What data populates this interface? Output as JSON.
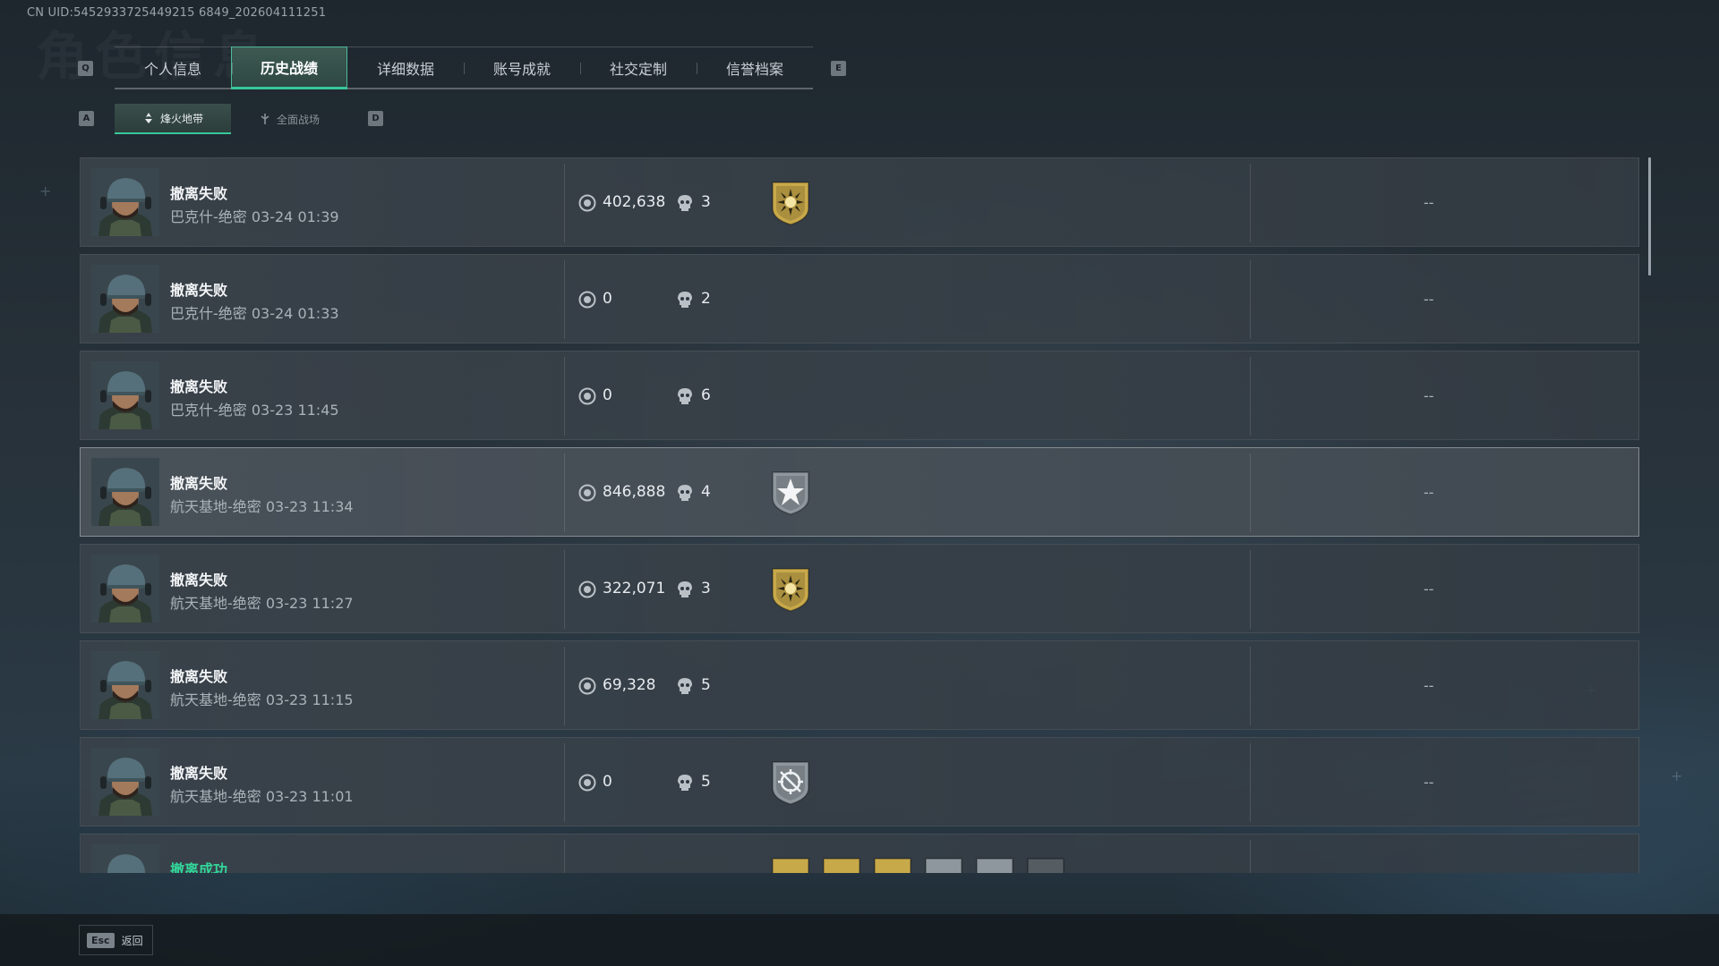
{
  "uid_text": "CN UID:5452933725449215 6849_202604111251",
  "background_title": "角色信息",
  "tabs": {
    "prev_key": "Q",
    "next_key": "E",
    "items": [
      {
        "label": "个人信息"
      },
      {
        "label": "历史战绩",
        "active": true
      },
      {
        "label": "详细数据"
      },
      {
        "label": "账号成就"
      },
      {
        "label": "社交定制"
      },
      {
        "label": "信誉档案"
      }
    ]
  },
  "subtabs": {
    "prev_key": "A",
    "next_key": "D",
    "items": [
      {
        "label": "烽火地带",
        "active": true,
        "icon": "flame-zone-icon"
      },
      {
        "label": "全面战场",
        "icon": "battlefield-icon"
      }
    ]
  },
  "records": [
    {
      "status": "撤离失败",
      "map": "巴克什-绝密 03-24 01:39",
      "value": "402,638",
      "kills": "3",
      "badge": "gold-sun",
      "result": "--"
    },
    {
      "status": "撤离失败",
      "map": "巴克什-绝密 03-24 01:33",
      "value": "0",
      "kills": "2",
      "badge": "",
      "result": "--"
    },
    {
      "status": "撤离失败",
      "map": "巴克什-绝密 03-23 11:45",
      "value": "0",
      "kills": "6",
      "badge": "",
      "result": "--"
    },
    {
      "status": "撤离失败",
      "map": "航天基地-绝密 03-23 11:34",
      "value": "846,888",
      "kills": "4",
      "badge": "silver-star",
      "result": "--",
      "selected": true
    },
    {
      "status": "撤离失败",
      "map": "航天基地-绝密 03-23 11:27",
      "value": "322,071",
      "kills": "3",
      "badge": "gold-sun",
      "result": "--"
    },
    {
      "status": "撤离失败",
      "map": "航天基地-绝密 03-23 11:15",
      "value": "69,328",
      "kills": "5",
      "badge": "",
      "result": "--"
    },
    {
      "status": "撤离失败",
      "map": "航天基地-绝密 03-23 11:01",
      "value": "0",
      "kills": "5",
      "badge": "silver-crosshair",
      "result": "--"
    },
    {
      "status": "撤离成功",
      "map": "",
      "value": "",
      "kills": "",
      "badge": "multi",
      "result": "",
      "success": true
    }
  ],
  "footer": {
    "esc_key": "Esc",
    "back_label": "返回"
  },
  "colors": {
    "accent": "#37c79a",
    "success_text": "#33d69a",
    "gold_badge": "#c8a94a",
    "silver_badge": "#8e979e"
  }
}
